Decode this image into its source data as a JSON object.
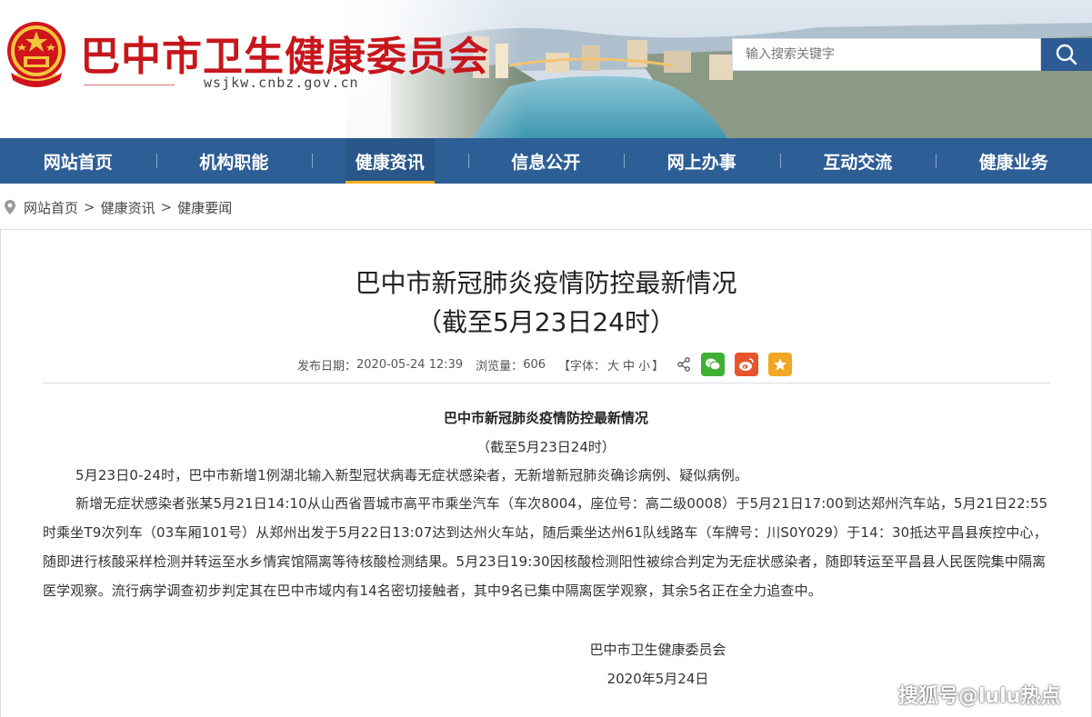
{
  "header": {
    "site_name": "巴中市卫生健康委员会",
    "domain": "wsjkw.cnbz.gov.cn",
    "search_placeholder": "输入搜索关键字"
  },
  "nav": {
    "items": [
      {
        "label": "网站首页",
        "active": false
      },
      {
        "label": "机构职能",
        "active": false
      },
      {
        "label": "健康资讯",
        "active": true
      },
      {
        "label": "信息公开",
        "active": false
      },
      {
        "label": "网上办事",
        "active": false
      },
      {
        "label": "互动交流",
        "active": false
      },
      {
        "label": "健康业务",
        "active": false
      }
    ]
  },
  "breadcrumb": {
    "items": [
      "网站首页",
      "健康资讯",
      "健康要闻"
    ],
    "separator": ">"
  },
  "article": {
    "title_line1": "巴中市新冠肺炎疫情防控最新情况",
    "title_line2": "（截至5月23日24时）",
    "meta": {
      "publish_label": "发布日期：",
      "publish_date": "2020-05-24 12:39",
      "views_label": "浏览量：",
      "views": "606",
      "font_label_open": "【字体：",
      "font_large": "大",
      "font_medium": "中",
      "font_small": "小",
      "font_label_close": "】"
    },
    "share_icons": [
      "share-icon",
      "wechat-icon",
      "weibo-icon",
      "favorite-icon"
    ],
    "body_title": "巴中市新冠肺炎疫情防控最新情况",
    "body_date": "（截至5月23日24时）",
    "paragraphs": [
      "5月23日0-24时，巴中市新增1例湖北输入新型冠状病毒无症状感染者，无新增新冠肺炎确诊病例、疑似病例。",
      "新增无症状感染者张某5月21日14:10从山西省晋城市高平市乘坐汽车（车次8004，座位号：高二级0008）于5月21日17:00到达郑州汽车站，5月21日22:55时乘坐T9次列车（03车厢101号）从郑州出发于5月22日13:07达到达州火车站，随后乘坐达州61队线路车（车牌号：川S0Y029）于14：30抵达平昌县疾控中心，随即进行核酸采样检测并转运至水乡情宾馆隔离等待核酸检测结果。5月23日19:30因核酸检测阳性被综合判定为无症状感染者，随即转运至平昌县人民医院集中隔离医学观察。流行病学调查初步判定其在巴中市域内有14名密切接触者，其中9名已集中隔离医学观察，其余5名正在全力追查中。"
    ],
    "signature": "巴中市卫生健康委员会",
    "signature_date": "2020年5月24日"
  },
  "watermark": "搜狐号@lulu热点",
  "colors": {
    "brand_red": "#c8161d",
    "nav_blue": "#2e5e96",
    "nav_active_underline": "#f2b01e",
    "wechat_green": "#3eb135",
    "weibo_orange": "#e8542c",
    "favorite_yellow": "#f3a623"
  }
}
